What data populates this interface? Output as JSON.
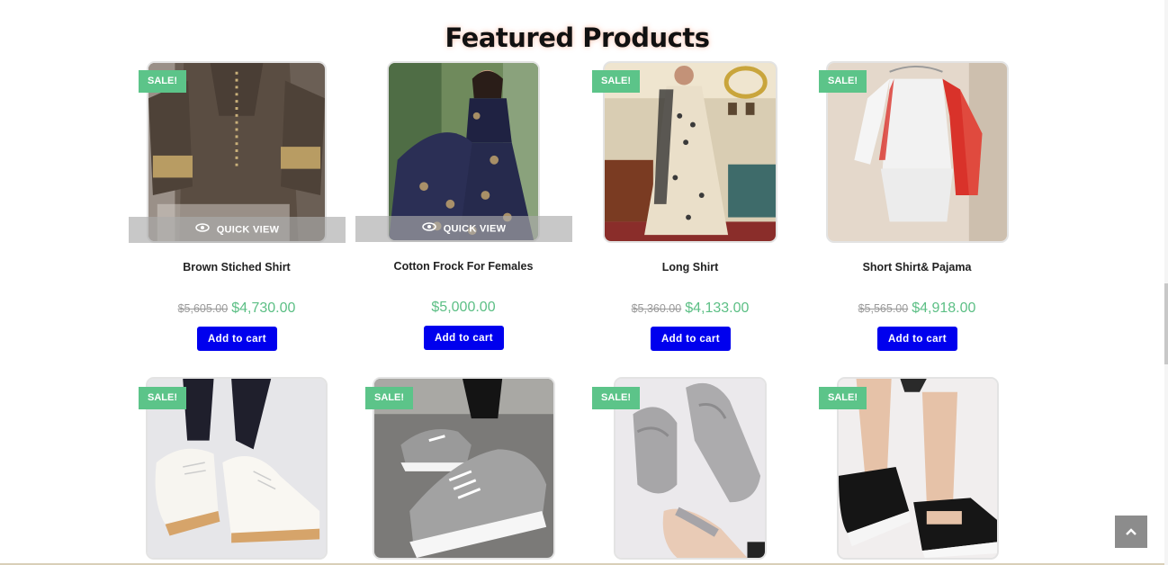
{
  "section": {
    "title": "Featured Products"
  },
  "labels": {
    "sale": "SALE!",
    "quick_view": "QUICK VIEW",
    "add_to_cart": "Add to cart"
  },
  "products": [
    {
      "name": "Brown Stiched Shirt",
      "old_price": "$5,605.00",
      "price": "$4,730.00",
      "on_sale": true
    },
    {
      "name": "Cotton Frock For Females",
      "old_price": "",
      "price": "$5,000.00",
      "on_sale": false
    },
    {
      "name": "Long Shirt",
      "old_price": "$5,360.00",
      "price": "$4,133.00",
      "on_sale": true
    },
    {
      "name": "Short Shirt& Pajama",
      "old_price": "$5,565.00",
      "price": "$4,918.00",
      "on_sale": true
    },
    {
      "name": "",
      "old_price": "",
      "price": "",
      "on_sale": true
    },
    {
      "name": "",
      "old_price": "",
      "price": "",
      "on_sale": true
    },
    {
      "name": "",
      "old_price": "",
      "price": "",
      "on_sale": true
    },
    {
      "name": "",
      "old_price": "",
      "price": "",
      "on_sale": true
    }
  ],
  "colors": {
    "sale_badge": "#5cc489",
    "price": "#5cbf85",
    "cart_button": "#0000ee",
    "scroll_top": "#8c8c8c"
  },
  "icons": {
    "quick_view": "eye-icon",
    "scroll_top": "chevron-up-icon"
  }
}
